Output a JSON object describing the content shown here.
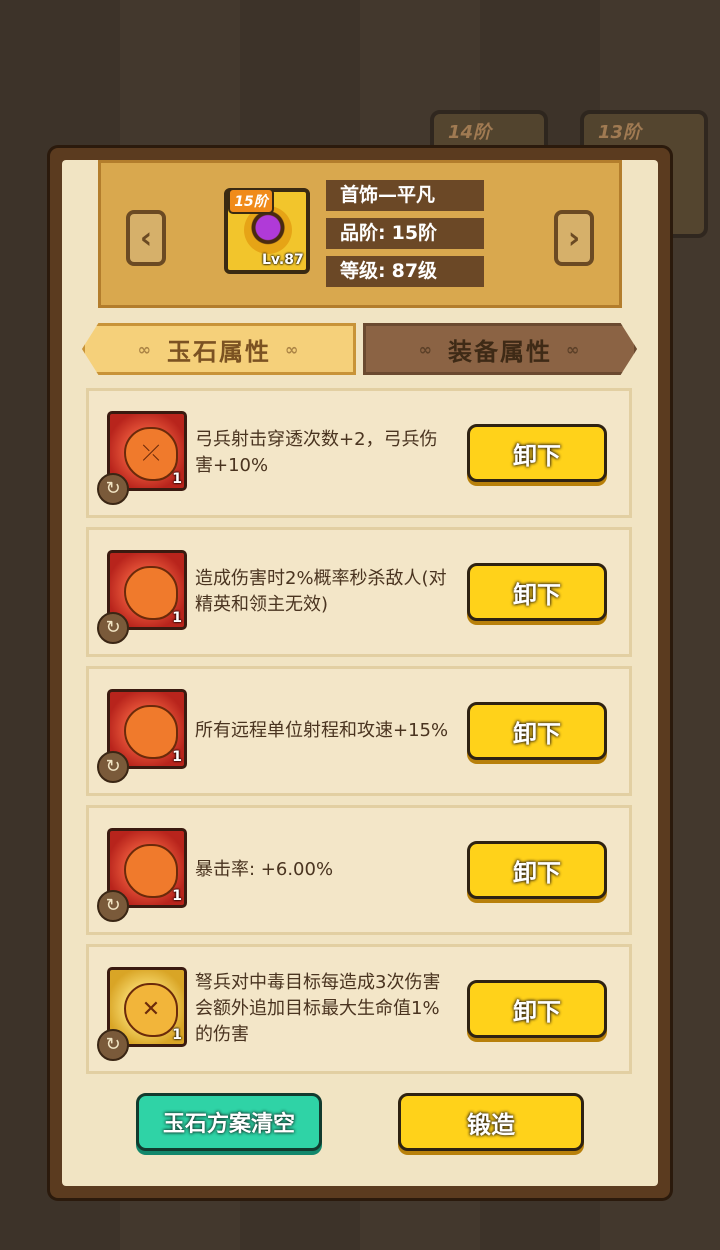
{
  "background": {
    "tags": [
      "14阶",
      "13阶"
    ]
  },
  "header": {
    "nav_prev": "‹",
    "nav_next": "›",
    "item": {
      "tier_badge": "15阶",
      "level": "Lv.87"
    },
    "name": "首饰—平凡",
    "grade_label": "品阶:",
    "grade_value": "15阶",
    "level_label": "等级:",
    "level_value": "87级"
  },
  "tabs": [
    {
      "label": "玉石属性",
      "active": true
    },
    {
      "label": "装备属性",
      "active": false
    }
  ],
  "jade_rows": [
    {
      "description": "弓兵射击穿透次数+2，弓兵伤害+10%",
      "count": "1",
      "color": "red",
      "icon": "bow-icon",
      "button": "卸下"
    },
    {
      "description": "造成伤害时2%概率秒杀敌人(对精英和领主无效)",
      "count": "1",
      "color": "red",
      "icon": "jade-stone-icon",
      "button": "卸下"
    },
    {
      "description": "所有远程单位射程和攻速+15%",
      "count": "1",
      "color": "red",
      "icon": "jade-stone-icon",
      "button": "卸下"
    },
    {
      "description": "暴击率: +6.00%",
      "count": "1",
      "color": "red",
      "icon": "jade-stone-icon",
      "button": "卸下"
    },
    {
      "description": "弩兵对中毒目标每造成3次伤害会额外追加目标最大生命值1%的伤害",
      "count": "1",
      "color": "gold",
      "icon": "crossbow-icon",
      "button": "卸下"
    }
  ],
  "footer": {
    "clear_label": "玉石方案清空",
    "forge_label": "锻造"
  },
  "colors": {
    "accent_yellow": "#ffd21a",
    "accent_green": "#2fd3a6",
    "panel_bg": "#f1e4c3",
    "frame": "#5b3b1f"
  }
}
